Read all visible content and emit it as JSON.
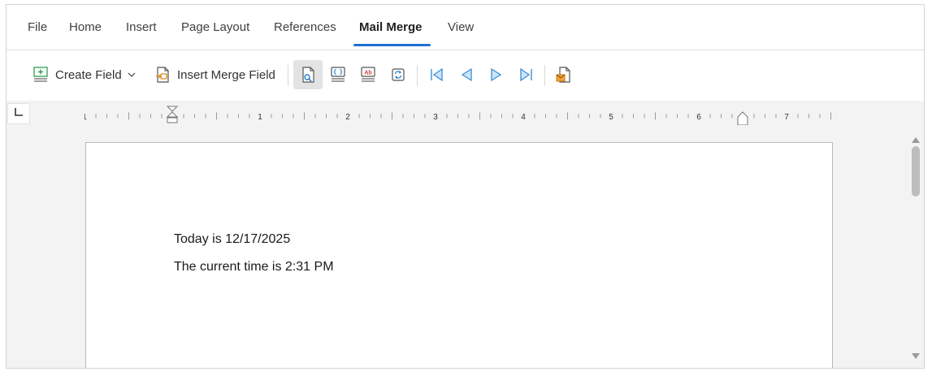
{
  "tabs": [
    {
      "label": "File"
    },
    {
      "label": "Home"
    },
    {
      "label": "Insert"
    },
    {
      "label": "Page Layout"
    },
    {
      "label": "References"
    },
    {
      "label": "Mail Merge",
      "active": true
    },
    {
      "label": "View"
    }
  ],
  "toolbar": {
    "create_field": "Create Field",
    "insert_merge_field": "Insert Merge Field",
    "icons": [
      "create-field-icon",
      "chevron-down-icon",
      "insert-merge-field-icon",
      "preview-results-icon",
      "show-field-codes-icon",
      "highlight-fields-icon",
      "update-fields-icon",
      "first-record-icon",
      "previous-record-icon",
      "next-record-icon",
      "last-record-icon",
      "finish-merge-icon"
    ]
  },
  "ruler": {
    "numbers": [
      "1",
      "1",
      "2",
      "3",
      "4",
      "5",
      "6",
      "7"
    ]
  },
  "document": {
    "line1": "Today is 12/17/2025",
    "line2": "The current time is 2:31 PM"
  },
  "colors": {
    "accent": "#1f6fd1",
    "nav_blue": "#3a8fd9"
  }
}
